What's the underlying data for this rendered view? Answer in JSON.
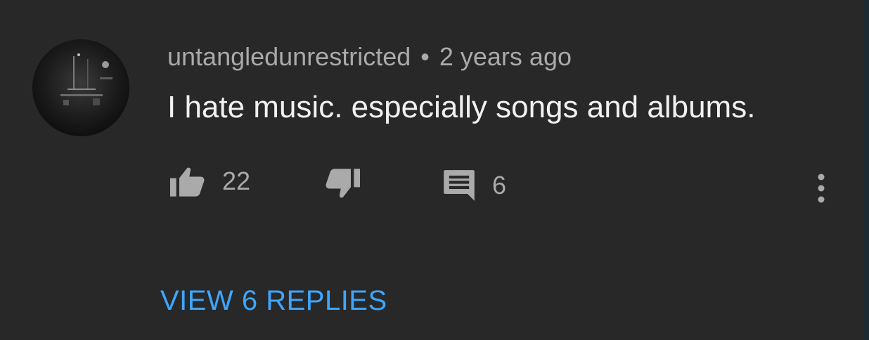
{
  "comment": {
    "author": "untangledunrestricted",
    "separator": "•",
    "timestamp": "2 years ago",
    "text": "I hate music. especially songs and albums.",
    "like_count": "22",
    "reply_count": "6"
  },
  "view_replies_label": "VIEW 6 REPLIES",
  "colors": {
    "background": "#282828",
    "meta_text": "#aaaaaa",
    "body_text": "#f1f1f1",
    "link": "#3ea6ff"
  },
  "icons": {
    "like": "thumbs-up-icon",
    "dislike": "thumbs-down-icon",
    "reply": "comment-icon",
    "more": "more-vertical-icon"
  }
}
